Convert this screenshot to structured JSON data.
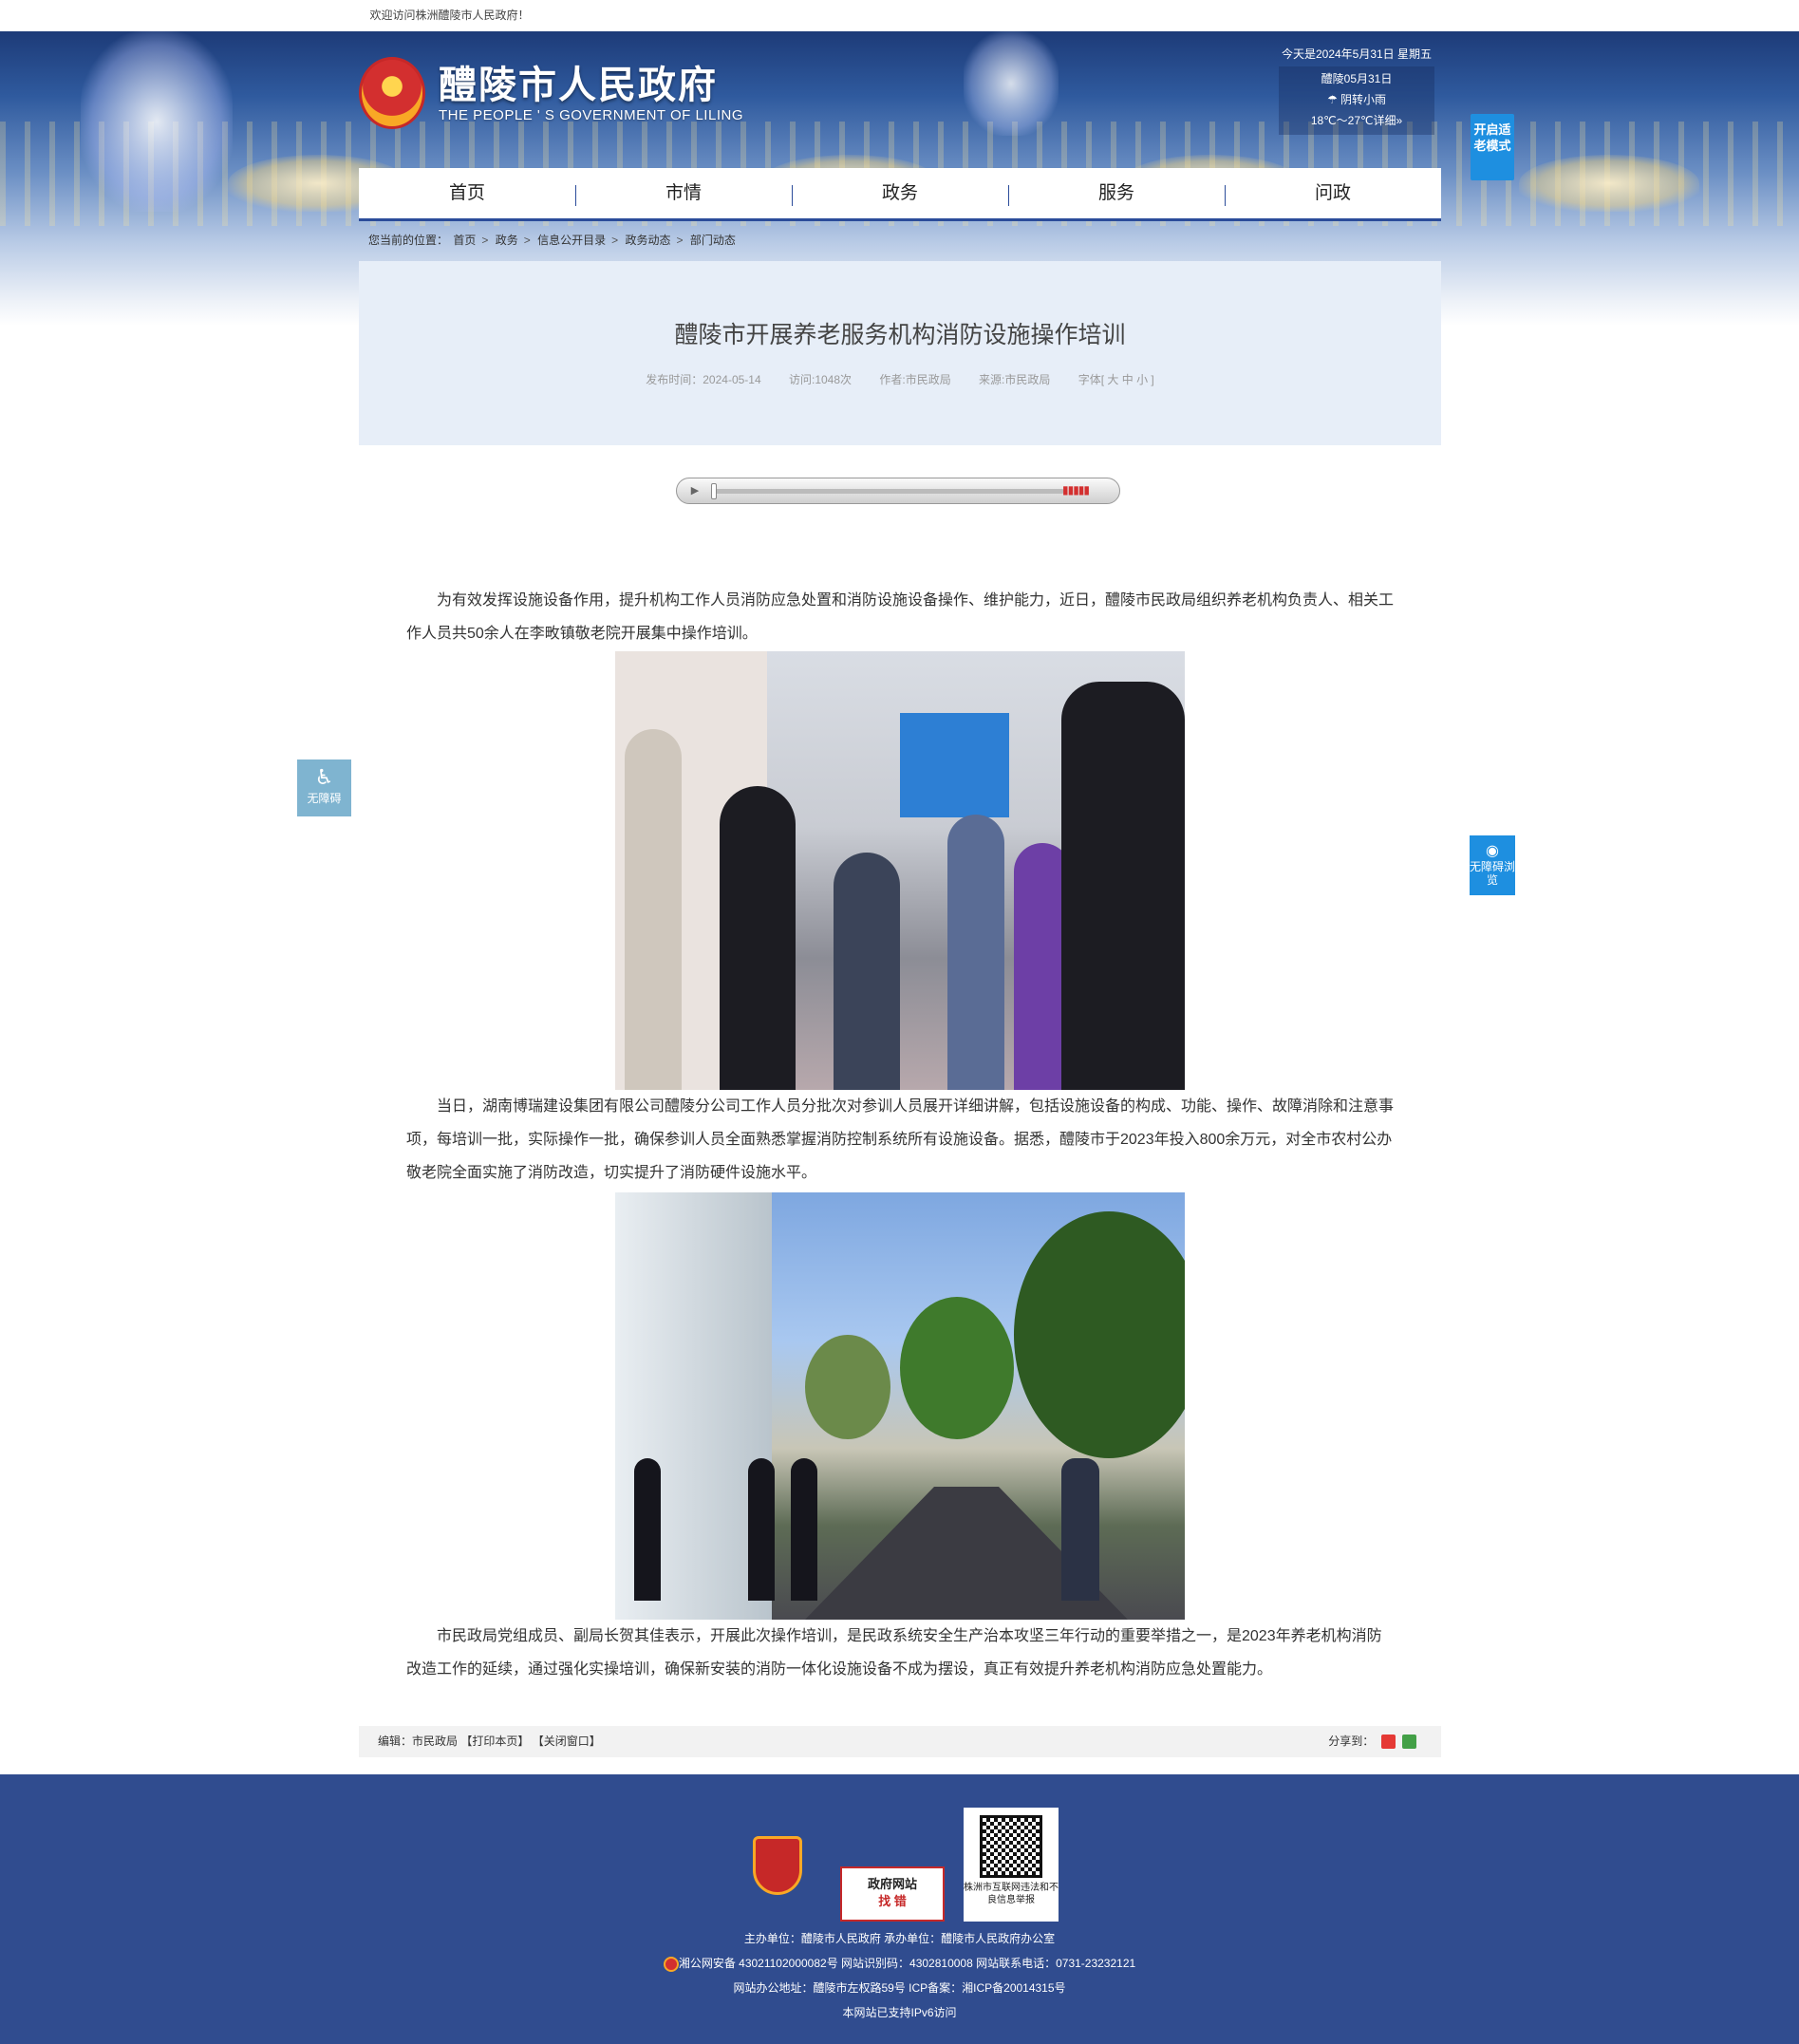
{
  "topbar": {
    "welcome": "欢迎访问株洲醴陵市人民政府！"
  },
  "header": {
    "title_cn": "醴陵市人民政府",
    "title_en": "THE PEOPLE ' S GOVERNMENT OF LILING"
  },
  "weather": {
    "today": "今天是2024年5月31日 星期五",
    "lunar": "醴陵05月31日",
    "condition": "阴转小雨",
    "temp": "18℃～27℃详细»"
  },
  "elder_mode": {
    "label": "开启适老模式"
  },
  "nav": {
    "items": [
      "首页",
      "市情",
      "政务",
      "服务",
      "问政"
    ]
  },
  "breadcrumb": {
    "prefix": "您当前的位置：",
    "items": [
      "首页",
      "政务",
      "信息公开目录",
      "政务动态",
      "部门动态"
    ]
  },
  "article": {
    "title": "醴陵市开展养老服务机构消防设施操作培训",
    "publish": "发布时间：2024-05-14",
    "visits": "访问:1048次",
    "author": "作者:市民政局",
    "source": "来源:市民政局",
    "font": "字体[ 大 中 小 ]",
    "p1": "为有效发挥设施设备作用，提升机构工作人员消防应急处置和消防设施设备操作、维护能力，近日，醴陵市民政局组织养老机构负责人、相关工作人员共50余人在李畋镇敬老院开展集中操作培训。",
    "p2": "当日，湖南博瑞建设集团有限公司醴陵分公司工作人员分批次对参训人员展开详细讲解，包括设施设备的构成、功能、操作、故障消除和注意事项，每培训一批，实际操作一批，确保参训人员全面熟悉掌握消防控制系统所有设施设备。据悉，醴陵市于2023年投入800余万元，对全市农村公办敬老院全面实施了消防改造，切实提升了消防硬件设施水平。",
    "p3": "市民政局党组成员、副局长贺其佳表示，开展此次操作培训，是民政系统安全生产治本攻坚三年行动的重要举措之一，是2023年养老机构消防改造工作的延续，通过强化实操培训，确保新安装的消防一体化设施设备不成为摆设，真正有效提升养老机构消防应急处置能力。"
  },
  "bottom": {
    "editor": "编辑：市民政局",
    "print": "【打印本页】",
    "close": "【关闭窗口】",
    "share": "分享到："
  },
  "accessibility": {
    "left": "无障碍",
    "right": "无障碍浏览"
  },
  "footer": {
    "party_label": "党政机关",
    "gov_err_top": "政府网站",
    "gov_err_bottom": "找 错",
    "qr_label": "株洲市互联网违法和不良信息举报",
    "line1": "主办单位：醴陵市人民政府 承办单位：醴陵市人民政府办公室",
    "line2": "湘公网安备 43021102000082号 网站识别码：4302810008 网站联系电话：0731-23232121",
    "line3": "网站办公地址：醴陵市左权路59号 ICP备案：湘ICP备20014315号",
    "line4": "本网站已支持IPv6访问"
  }
}
